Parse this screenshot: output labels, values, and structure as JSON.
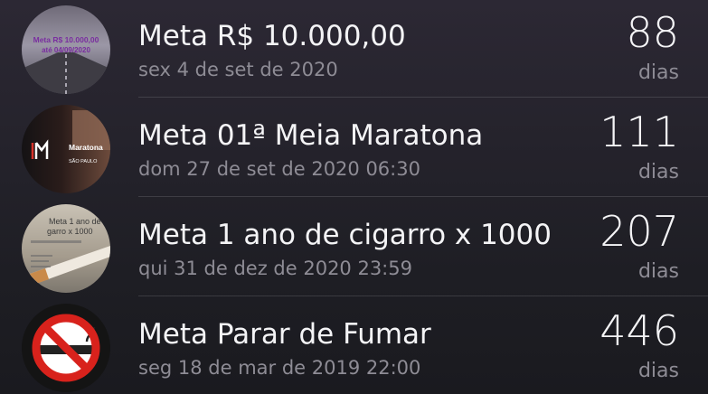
{
  "goals": [
    {
      "title": "Meta R$ 10.000,00",
      "date": "sex 4 de set de 2020",
      "count": "88",
      "unit": "dias",
      "thumb_icon": "money-goal-thumbnail",
      "thumb_text_1": "Meta R$ 10.000,00",
      "thumb_text_2": "até 04/09/2020"
    },
    {
      "title": "Meta 01ª Meia Maratona",
      "date": "dom 27 de set de 2020 06:30",
      "count": "111",
      "unit": "dias",
      "thumb_icon": "half-marathon-thumbnail",
      "thumb_text_1": "Maratona",
      "thumb_text_2": "SÃO PAULO"
    },
    {
      "title": "Meta 1 ano de cigarro x 1000",
      "date": "qui 31 de dez de 2020 23:59",
      "count": "207",
      "unit": "dias",
      "thumb_icon": "cigarette-cost-thumbnail",
      "thumb_text_1": "Meta 1 ano de",
      "thumb_text_2": "garro x 1000"
    },
    {
      "title": "Meta Parar de Fumar",
      "date": "seg 18 de mar de 2019 22:00",
      "count": "446",
      "unit": "dias",
      "thumb_icon": "no-smoking-icon"
    }
  ],
  "colors": {
    "title": "#f4f4f6",
    "secondary": "#8e8c95",
    "separator": "rgba(255,255,255,0.13)",
    "no_smoking_red": "#d8221c"
  }
}
